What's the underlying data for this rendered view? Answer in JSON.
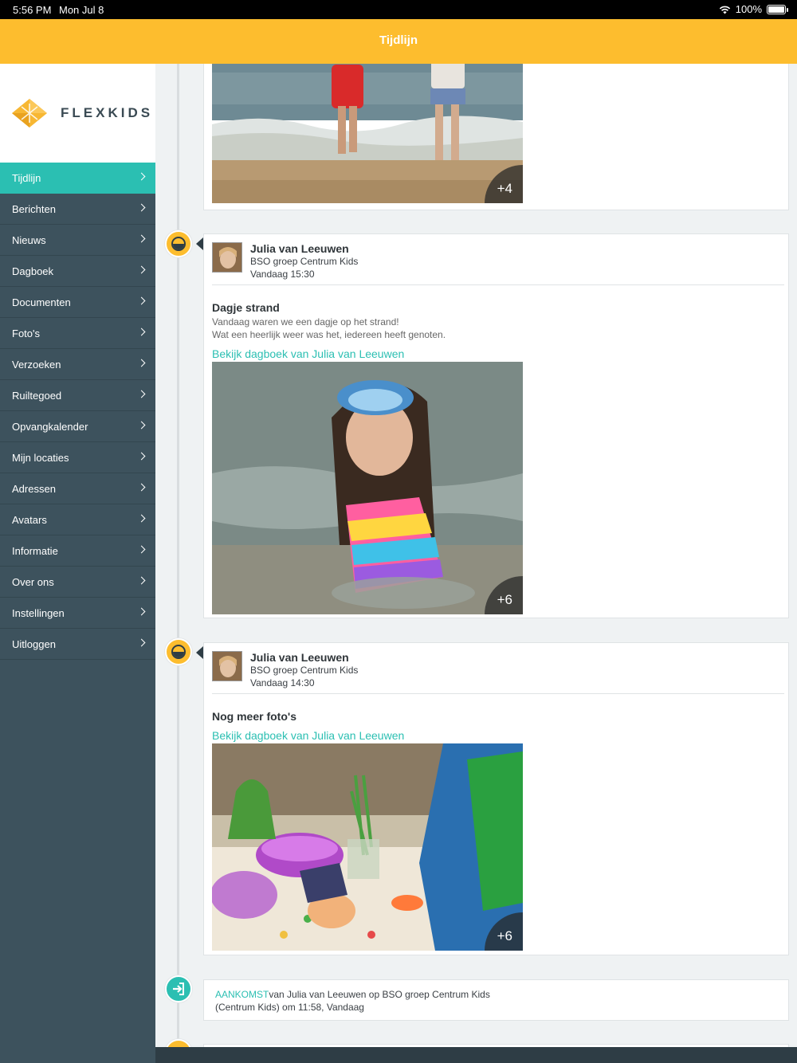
{
  "status_bar": {
    "time": "5:56 PM",
    "date": "Mon Jul 8",
    "battery": "100%"
  },
  "header": {
    "title": "Tijdlijn"
  },
  "brand": {
    "name": "FLEXKIDS"
  },
  "sidebar": {
    "items": [
      {
        "label": "Tijdlijn",
        "active": true
      },
      {
        "label": "Berichten"
      },
      {
        "label": "Nieuws"
      },
      {
        "label": "Dagboek"
      },
      {
        "label": "Documenten"
      },
      {
        "label": "Foto's"
      },
      {
        "label": "Verzoeken"
      },
      {
        "label": "Ruiltegoed"
      },
      {
        "label": "Opvangkalender"
      },
      {
        "label": "Mijn locaties"
      },
      {
        "label": "Adressen"
      },
      {
        "label": "Avatars"
      },
      {
        "label": "Informatie"
      },
      {
        "label": "Over ons"
      },
      {
        "label": "Instellingen"
      },
      {
        "label": "Uitloggen"
      }
    ]
  },
  "posts": [
    {
      "more_photos": "+4"
    },
    {
      "author": "Julia van Leeuwen",
      "group": "BSO groep Centrum Kids",
      "time": "Vandaag 15:30",
      "title": "Dagje strand",
      "body_line1": "Vandaag waren we een dagje op het strand!",
      "body_line2": "Wat een heerlijk weer was het, iedereen heeft genoten.",
      "link": "Bekijk dagboek van Julia van Leeuwen",
      "more_photos": "+6"
    },
    {
      "author": "Julia van Leeuwen",
      "group": "BSO groep Centrum Kids",
      "time": "Vandaag 14:30",
      "title": "Nog meer foto's",
      "link": "Bekijk dagboek van Julia van Leeuwen",
      "more_photos": "+6"
    }
  ],
  "arrival": {
    "tag": "AANKOMST",
    "line1": "van Julia van Leeuwen op BSO groep Centrum Kids",
    "line2": "(Centrum Kids) om 11:58, Vandaag"
  },
  "colors": {
    "accent": "#fdbd2e",
    "teal": "#2bbfb2",
    "sidebar": "#3d525d"
  }
}
